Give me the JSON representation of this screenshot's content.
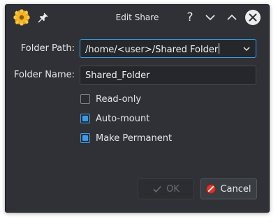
{
  "window": {
    "title": "Edit Share"
  },
  "titlebar": {
    "icons": [
      "app-gear-icon",
      "pin-icon",
      "help-icon",
      "minimize-icon",
      "maximize-icon",
      "close-icon"
    ],
    "help_glyph": "?"
  },
  "form": {
    "folder_path_label": "Folder Path:",
    "folder_path_value": "/home/<user>/Shared Folder",
    "folder_name_label": "Folder Name:",
    "folder_name_value": "Shared_Folder"
  },
  "options": {
    "read_only_label": "Read-only",
    "read_only_checked": false,
    "auto_mount_label": "Auto-mount",
    "auto_mount_checked": true,
    "make_permanent_label": "Make Permanent",
    "make_permanent_checked": true
  },
  "buttons": {
    "ok_label": "OK",
    "ok_enabled": false,
    "cancel_label": "Cancel"
  },
  "colors": {
    "accent": "#3b9be6",
    "window_bg": "#2f3136",
    "cancel_icon": "#d9342b"
  }
}
